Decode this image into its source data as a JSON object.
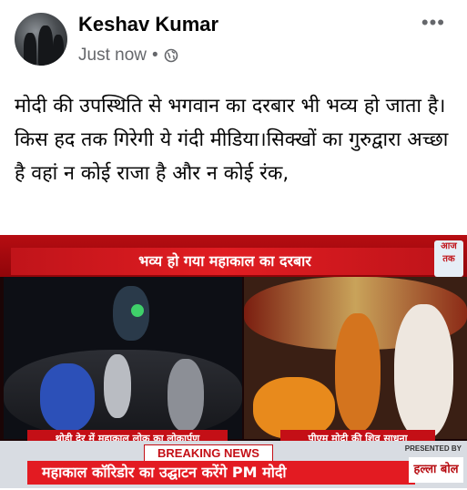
{
  "author": {
    "name": "Keshav Kumar"
  },
  "meta": {
    "time": "Just now",
    "separator": "•",
    "privacy_icon": "globe-icon"
  },
  "more_label": "•••",
  "post": {
    "text": "मोदी की उपस्थिति से भगवान का दरबार भी भव्य हो जाता है।किस हद तक गिरेगी ये गंदी मीडिया।सिक्खों का गुरुद्वारा अच्छा है वहां न कोई राजा है और न कोई रंक,"
  },
  "image": {
    "headline": "भव्य हो गया महाकाल का दरबार",
    "caption_left": "थोड़ी देर में महाकाल लोक का लोकार्पण",
    "caption_right": "पीएम मोदी की शिव साधना",
    "breaking": "BREAKING NEWS",
    "ticker": "महाकाल कॉरिडोर का उद्घाटन करेंगे PM मोदी",
    "presented_by": "PRESENTED BY",
    "sponsor": "हल्ला बोल",
    "logo": "आज तक"
  }
}
